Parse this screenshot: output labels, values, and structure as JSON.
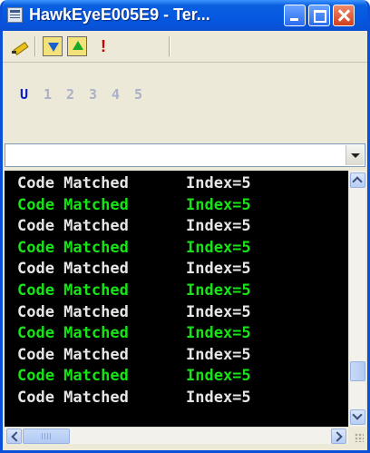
{
  "window": {
    "title": "HawkEyeE005E9 - Ter..."
  },
  "numbar": [
    "U",
    "1",
    "2",
    "3",
    "4",
    "5"
  ],
  "terminal": {
    "lines": [
      {
        "text": "Code Matched",
        "index": "Index=5",
        "color": "#e6e6e6"
      },
      {
        "text": "Code Matched",
        "index": "Index=5",
        "color": "#17e317"
      },
      {
        "text": "Code Matched",
        "index": "Index=5",
        "color": "#e6e6e6"
      },
      {
        "text": "Code Matched",
        "index": "Index=5",
        "color": "#17e317"
      },
      {
        "text": "Code Matched",
        "index": "Index=5",
        "color": "#e6e6e6"
      },
      {
        "text": "Code Matched",
        "index": "Index=5",
        "color": "#17e317"
      },
      {
        "text": "Code Matched",
        "index": "Index=5",
        "color": "#e6e6e6"
      },
      {
        "text": "Code Matched",
        "index": "Index=5",
        "color": "#17e317"
      },
      {
        "text": "Code Matched",
        "index": "Index=5",
        "color": "#e6e6e6"
      },
      {
        "text": "Code Matched",
        "index": "Index=5",
        "color": "#17e317"
      },
      {
        "text": "Code Matched",
        "index": "Index=5",
        "color": "#e6e6e6"
      }
    ]
  },
  "colors": {
    "titlebar": "#0558e0",
    "terminal_bg": "#000000",
    "text_white": "#e6e6e6",
    "text_green": "#17e317",
    "selected_number": "#0a1cc8",
    "dim_number": "#aab0c8"
  },
  "icons": {
    "app": "terminal-app-icon",
    "edit": "pencil-icon",
    "down": "download-arrow-icon",
    "up": "upload-arrow-icon",
    "alert": "exclamation-icon"
  }
}
